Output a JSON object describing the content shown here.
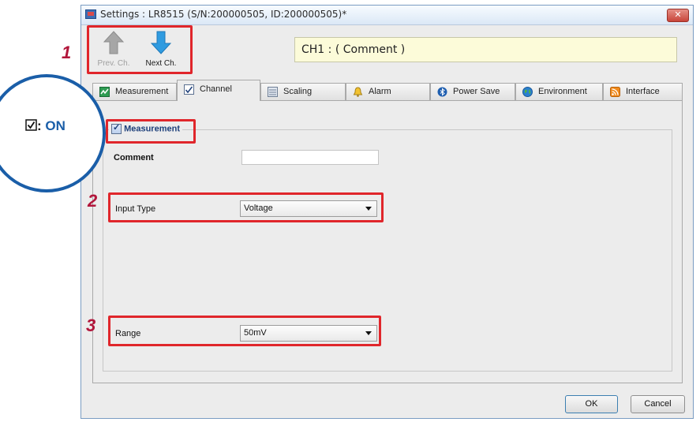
{
  "window": {
    "title": "Settings : LR8515 (S/N:200000505, ID:200000505)*",
    "close_label": "✕"
  },
  "nav": {
    "prev_label": "Prev. Ch.",
    "next_label": "Next Ch."
  },
  "channel_comment": "CH1 : ( Comment )",
  "tabs": [
    {
      "label": "Measurement",
      "icon": "measurement-icon"
    },
    {
      "label": "Channel",
      "icon": "channel-check-icon"
    },
    {
      "label": "Scaling",
      "icon": "scaling-icon"
    },
    {
      "label": "Alarm",
      "icon": "bell-icon"
    },
    {
      "label": "Power Save",
      "icon": "bluetooth-icon"
    },
    {
      "label": "Environment",
      "icon": "globe-icon"
    },
    {
      "label": "Interface",
      "icon": "rss-icon"
    }
  ],
  "active_tab": "Channel",
  "measurement": {
    "label": "Measurement",
    "checked": true
  },
  "form": {
    "comment_label": "Comment",
    "comment_value": "",
    "input_type_label": "Input Type",
    "input_type_value": "Voltage",
    "range_label": "Range",
    "range_value": "50mV"
  },
  "annotations": {
    "step1": "1",
    "step2": "2",
    "step3": "3",
    "callout_colon": ":",
    "callout_on": "ON"
  },
  "buttons": {
    "ok": "OK",
    "cancel": "Cancel"
  },
  "colors": {
    "highlight": "#e0262b",
    "step_number": "#b2163b",
    "callout_border": "#1a5ea8",
    "comment_bg": "#fcfbd9"
  }
}
